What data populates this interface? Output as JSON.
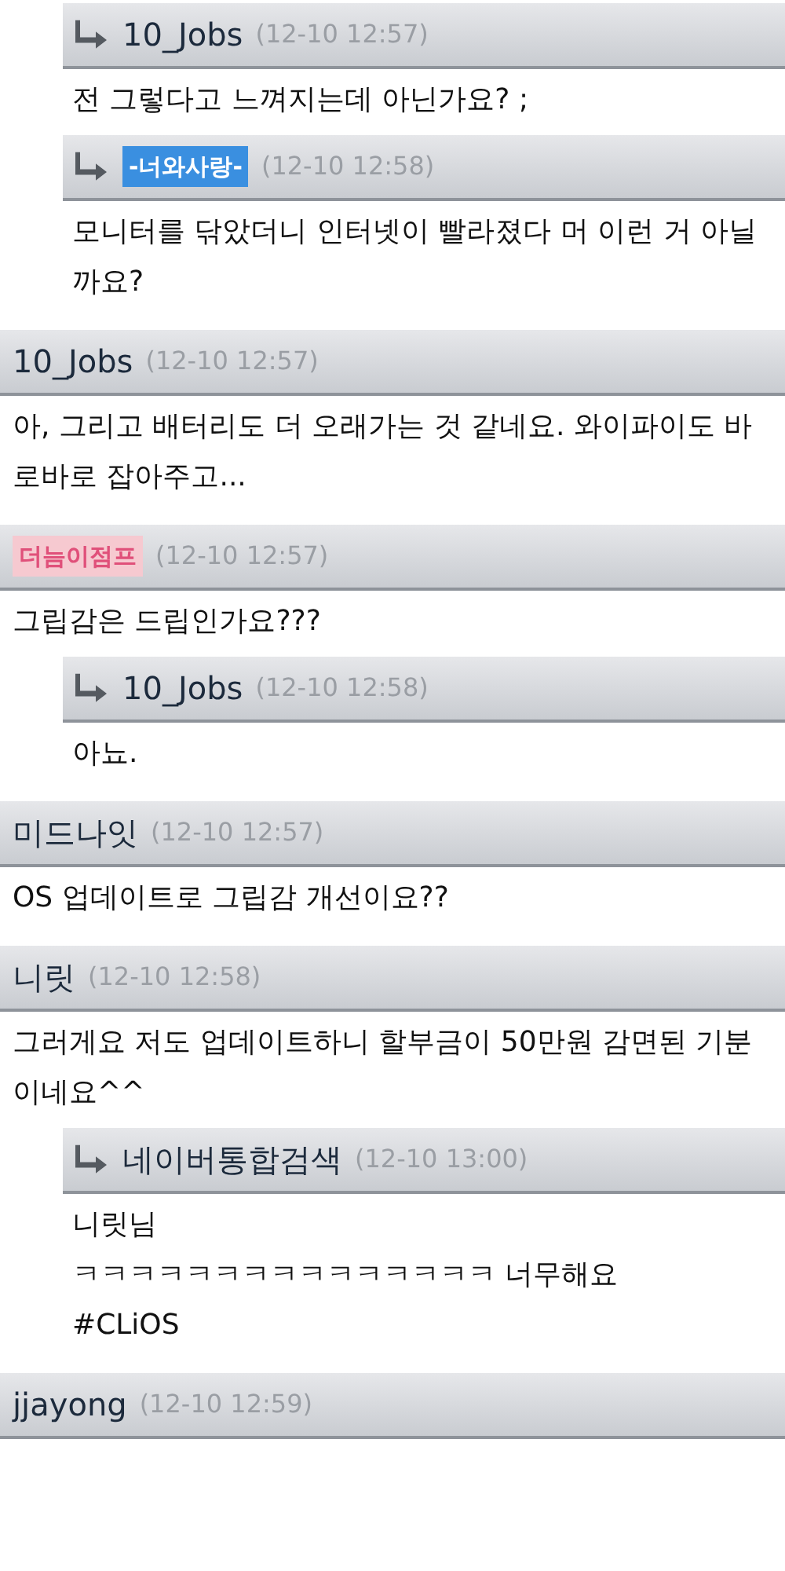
{
  "comments": [
    {
      "reply": true,
      "author": {
        "kind": "text",
        "name": "10_Jobs"
      },
      "time": "(12-10 12:57)",
      "lines": [
        "전 그렇다고 느껴지는데 아닌가요? ;"
      ]
    },
    {
      "reply": true,
      "author": {
        "kind": "badge",
        "name": "-너와사랑-",
        "color": "#3a8fe0"
      },
      "time": "(12-10 12:58)",
      "lines": [
        "모니터를 닦았더니 인터넷이 빨라졌다 머 이런 거 아닐까요?"
      ]
    },
    {
      "reply": false,
      "author": {
        "kind": "text",
        "name": "10_Jobs"
      },
      "time": "(12-10 12:57)",
      "lines": [
        "아, 그리고 배터리도 더 오래가는 것 같네요. 와이파이도 바로바로 잡아주고..."
      ]
    },
    {
      "reply": false,
      "author": {
        "kind": "badge",
        "name": "더늠이점프",
        "color": "#f6c9d0"
      },
      "time": "(12-10 12:57)",
      "lines": [
        "그립감은 드립인가요???"
      ]
    },
    {
      "reply": true,
      "author": {
        "kind": "text",
        "name": "10_Jobs"
      },
      "time": "(12-10 12:58)",
      "lines": [
        "아뇨."
      ]
    },
    {
      "reply": false,
      "author": {
        "kind": "text",
        "name": "미드나잇"
      },
      "time": "(12-10 12:57)",
      "lines": [
        "OS 업데이트로 그립감 개선이요??"
      ]
    },
    {
      "reply": false,
      "author": {
        "kind": "text",
        "name": "니릿"
      },
      "time": "(12-10 12:58)",
      "lines": [
        "그러게요 저도 업데이트하니 할부금이 50만원 감면된 기분이네요^^"
      ]
    },
    {
      "reply": true,
      "author": {
        "kind": "text",
        "name": "네이버통합검색"
      },
      "time": "(12-10 13:00)",
      "lines": [
        "니릿님",
        "ㅋㅋㅋㅋㅋㅋㅋㅋㅋㅋㅋㅋㅋㅋㅋ 너무해요",
        "#CLiOS"
      ]
    },
    {
      "reply": false,
      "author": {
        "kind": "text",
        "name": "jjayong"
      },
      "time": "(12-10 12:59)"
    }
  ]
}
